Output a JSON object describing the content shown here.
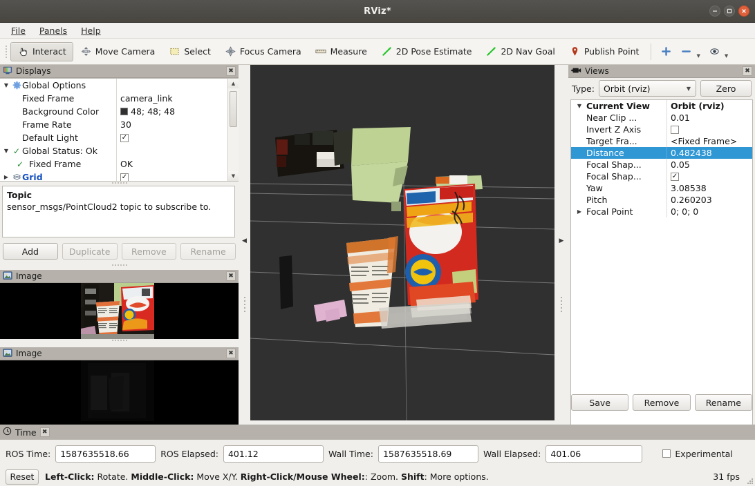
{
  "window": {
    "title": "RViz*",
    "minimize": "–",
    "maximize": "□",
    "close": "×"
  },
  "menubar": {
    "items": [
      {
        "label": "File",
        "mnemonic": "F"
      },
      {
        "label": "Panels",
        "mnemonic": "P"
      },
      {
        "label": "Help",
        "mnemonic": "H"
      }
    ]
  },
  "toolbar": {
    "items": [
      {
        "label": "Interact",
        "icon": "hand-cursor-icon",
        "active": true
      },
      {
        "label": "Move Camera",
        "icon": "move-camera-icon",
        "active": false
      },
      {
        "label": "Select",
        "icon": "select-rect-icon",
        "active": false
      },
      {
        "label": "Focus Camera",
        "icon": "focus-camera-icon",
        "active": false
      },
      {
        "label": "Measure",
        "icon": "ruler-icon",
        "active": false
      },
      {
        "label": "2D Pose Estimate",
        "icon": "pose-arrow-icon",
        "active": false
      },
      {
        "label": "2D Nav Goal",
        "icon": "nav-goal-arrow-icon",
        "active": false
      },
      {
        "label": "Publish Point",
        "icon": "map-pin-icon",
        "active": false
      }
    ],
    "extra": [
      {
        "label": "",
        "icon": "plus-icon"
      },
      {
        "label": "",
        "icon": "minus-icon"
      },
      {
        "label": "",
        "icon": "eye-icon"
      }
    ]
  },
  "displays": {
    "title": "Displays",
    "title_icon": "monitor-icon",
    "close_label": "✖",
    "rows": [
      {
        "indent": 0,
        "expander": "▼",
        "icon": "gear-icon",
        "name": "Global Options",
        "value_type": "none",
        "value": "",
        "bold": false
      },
      {
        "indent": 1,
        "expander": "",
        "icon": "",
        "name": "Fixed Frame",
        "value_type": "text",
        "value": "camera_link"
      },
      {
        "indent": 1,
        "expander": "",
        "icon": "",
        "name": "Background Color",
        "value_type": "color",
        "value": "48; 48; 48",
        "color": "#303030"
      },
      {
        "indent": 1,
        "expander": "",
        "icon": "",
        "name": "Frame Rate",
        "value_type": "text",
        "value": "30"
      },
      {
        "indent": 1,
        "expander": "",
        "icon": "",
        "name": "Default Light",
        "value_type": "check",
        "value": "✓"
      },
      {
        "indent": 0,
        "expander": "▼",
        "icon": "check-ok-icon",
        "name": "Global Status: Ok",
        "value_type": "none",
        "value": ""
      },
      {
        "indent": 1,
        "expander": "",
        "icon": "check-ok-icon",
        "name": "Fixed Frame",
        "value_type": "text",
        "value": "OK"
      },
      {
        "indent": 0,
        "expander": "▶",
        "icon": "grid-icon",
        "name": "Grid",
        "value_type": "check",
        "value": "✓",
        "link": true
      }
    ],
    "help": {
      "heading": "Topic",
      "body": "sensor_msgs/PointCloud2 topic to subscribe to."
    },
    "buttons": [
      {
        "label": "Add",
        "enabled": true
      },
      {
        "label": "Duplicate",
        "enabled": false
      },
      {
        "label": "Remove",
        "enabled": false
      },
      {
        "label": "Rename",
        "enabled": false
      }
    ]
  },
  "image_panels": [
    {
      "title": "Image",
      "title_icon": "image-icon",
      "close_label": "✖"
    },
    {
      "title": "Image",
      "title_icon": "image-icon",
      "close_label": "✖"
    }
  ],
  "views": {
    "title": "Views",
    "title_icon": "camera-icon",
    "close_label": "✖",
    "type_label": "Type:",
    "type_value": "Orbit (rviz)",
    "zero_button": "Zero",
    "rows": [
      {
        "expander": "▼",
        "name": "Current View",
        "value": "Orbit (rviz)",
        "bold": true,
        "value_type": "text",
        "selected": false
      },
      {
        "expander": "",
        "name": "Near Clip ...",
        "value": "0.01",
        "bold": false,
        "value_type": "text",
        "selected": false
      },
      {
        "expander": "",
        "name": "Invert Z Axis",
        "value": "",
        "bold": false,
        "value_type": "uncheck",
        "selected": false
      },
      {
        "expander": "",
        "name": "Target Fra...",
        "value": "<Fixed Frame>",
        "bold": false,
        "value_type": "text",
        "selected": false
      },
      {
        "expander": "",
        "name": "Distance",
        "value": "0.482438",
        "bold": false,
        "value_type": "text",
        "selected": true
      },
      {
        "expander": "",
        "name": "Focal Shap...",
        "value": "0.05",
        "bold": false,
        "value_type": "text",
        "selected": false
      },
      {
        "expander": "",
        "name": "Focal Shap...",
        "value": "✓",
        "bold": false,
        "value_type": "check",
        "selected": false
      },
      {
        "expander": "",
        "name": "Yaw",
        "value": "3.08538",
        "bold": false,
        "value_type": "text",
        "selected": false
      },
      {
        "expander": "",
        "name": "Pitch",
        "value": "0.260203",
        "bold": false,
        "value_type": "text",
        "selected": false
      },
      {
        "expander": "▶",
        "name": "Focal Point",
        "value": "0; 0; 0",
        "bold": false,
        "value_type": "text",
        "selected": false
      }
    ],
    "buttons": [
      {
        "label": "Save",
        "enabled": true
      },
      {
        "label": "Remove",
        "enabled": true
      },
      {
        "label": "Rename",
        "enabled": true
      }
    ]
  },
  "time": {
    "title": "Time",
    "title_icon": "clock-icon",
    "close_label": "✖",
    "fields": [
      {
        "label": "ROS Time:",
        "value": "1587635518.66"
      },
      {
        "label": "ROS Elapsed:",
        "value": "401.12"
      },
      {
        "label": "Wall Time:",
        "value": "1587635518.69"
      },
      {
        "label": "Wall Elapsed:",
        "value": "401.06"
      }
    ],
    "experimental_label": "Experimental",
    "experimental_checked": false
  },
  "statusbar": {
    "reset_label": "Reset",
    "hint_parts": [
      {
        "text": "Left-Click:",
        "bold": true
      },
      {
        "text": " Rotate. ",
        "bold": false
      },
      {
        "text": "Middle-Click:",
        "bold": true
      },
      {
        "text": " Move X/Y. ",
        "bold": false
      },
      {
        "text": "Right-Click/Mouse Wheel:",
        "bold": true
      },
      {
        "text": ": Zoom. ",
        "bold": false
      },
      {
        "text": "Shift",
        "bold": true
      },
      {
        "text": ": More options.",
        "bold": false
      }
    ],
    "fps": "31 fps"
  },
  "colors": {
    "titlebar": "#4e4c48",
    "panel_header": "#b6b2ab",
    "panel_bg": "#f0efec",
    "viewport_bg": "#303030",
    "selection_blue": "#2f97d4",
    "link_blue": "#1652c0",
    "close_red": "#e0603c",
    "ok_green": "#1f8a2f"
  }
}
